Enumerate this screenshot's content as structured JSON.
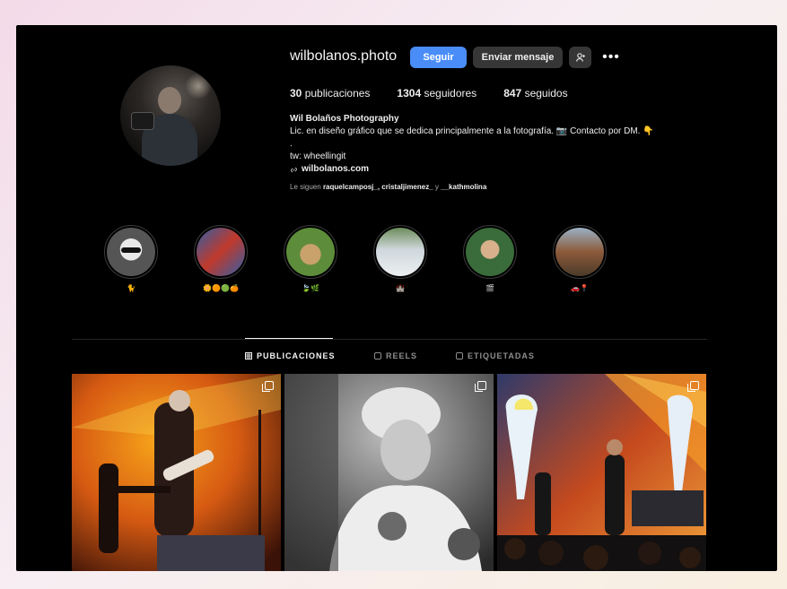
{
  "profile": {
    "username": "wilbolanos.photo",
    "follow_label": "Seguir",
    "message_label": "Enviar mensaje",
    "more_label": "•••"
  },
  "stats": {
    "posts_count": "30",
    "posts_label": "publicaciones",
    "followers_count": "1304",
    "followers_label": "seguidores",
    "following_count": "847",
    "following_label": "seguidos"
  },
  "bio": {
    "name": "Wil Bolaños Photography",
    "line1": "Lic. en diseño gráfico que se dedica principalmente a la fotografía. 📷 Contacto por DM. 👇",
    "line2": ".",
    "line3": "tw: wheellingit",
    "link": "wilbolanos.com",
    "followed_prefix": "Le siguen",
    "followed_names": "raquelcamposj_, cristaljimenez_",
    "followed_and": "y",
    "followed_last": "__kathmolina"
  },
  "highlights": [
    {
      "label": "🐈",
      "colors": [
        "#ddd",
        "#555"
      ]
    },
    {
      "label": "🌼🟠🟢🍊",
      "colors": [
        "#2f5fa8",
        "#c0392b"
      ]
    },
    {
      "label": "🍃🌿",
      "colors": [
        "#5d8c3a",
        "#c9a26b"
      ]
    },
    {
      "label": "🏰",
      "colors": [
        "#cfd8dc",
        "#6d8c5a"
      ]
    },
    {
      "label": "🎬",
      "colors": [
        "#3a6b3a",
        "#d8b08c"
      ]
    },
    {
      "label": "🚗📍",
      "colors": [
        "#9ab0c4",
        "#8c5a3a"
      ]
    }
  ],
  "tabs": {
    "posts": "PUBLICACIONES",
    "reels": "REELS",
    "tagged": "ETIQUETADAS"
  },
  "icons": {
    "user_add": "user-plus-icon",
    "link": "link-icon",
    "grid": "grid-icon",
    "reels": "reels-icon",
    "tagged": "tag-icon",
    "multi": "carousel-icon"
  }
}
